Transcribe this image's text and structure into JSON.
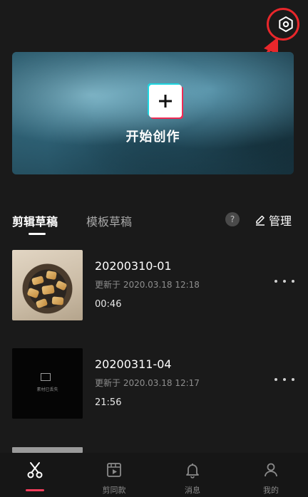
{
  "header": {
    "settings_icon": "settings-hexagon-icon"
  },
  "hero": {
    "label": "开始创作",
    "plus_icon": "plus-icon"
  },
  "tabs": [
    {
      "label": "剪辑草稿",
      "active": true
    },
    {
      "label": "模板草稿",
      "active": false
    }
  ],
  "help": {
    "label": "?"
  },
  "manage": {
    "label": "管理",
    "icon": "pencil-icon"
  },
  "drafts": [
    {
      "name": "20200310-01",
      "updated": "更新于 2020.03.18 12:18",
      "duration": "00:46",
      "thumbnail": "food-pan"
    },
    {
      "name": "20200311-04",
      "updated": "更新于 2020.03.18 12:17",
      "duration": "21:56",
      "thumbnail": "black-screen",
      "thumbnail_text": "素材已丢失"
    }
  ],
  "nav": [
    {
      "label": "",
      "icon": "scissors-icon",
      "active": true
    },
    {
      "label": "剪同款",
      "icon": "video-template-icon",
      "active": false
    },
    {
      "label": "消息",
      "icon": "bell-icon",
      "active": false
    },
    {
      "label": "我的",
      "icon": "person-icon",
      "active": false
    }
  ],
  "colors": {
    "background": "#1a1a1a",
    "accent": "#f03c5a",
    "annotation": "#e8272b"
  }
}
